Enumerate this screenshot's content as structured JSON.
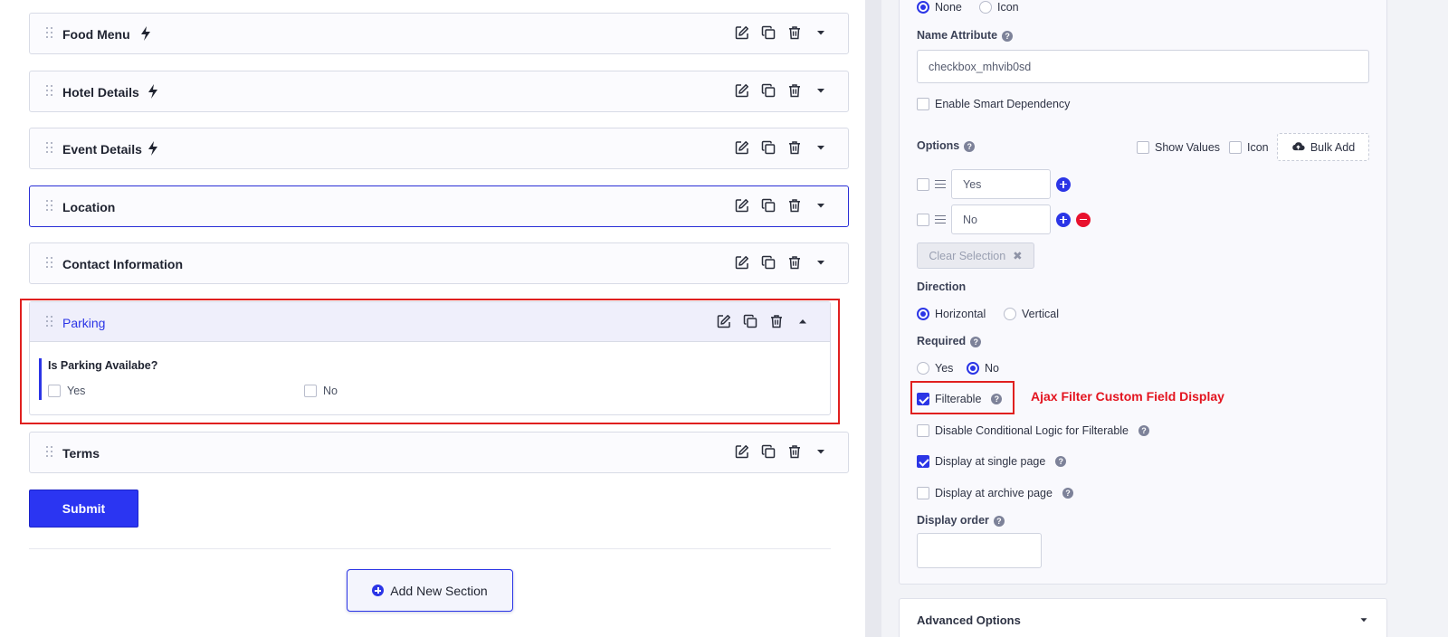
{
  "sections": [
    {
      "title": "Food Menu",
      "bolt": true
    },
    {
      "title": "Hotel Details",
      "bolt": true
    },
    {
      "title": "Event Details",
      "bolt": true
    },
    {
      "title": "Location",
      "bolt": false
    },
    {
      "title": "Contact Information",
      "bolt": false
    },
    {
      "title": "Parking",
      "bolt": false
    },
    {
      "title": "Terms",
      "bolt": false
    }
  ],
  "parking_field": {
    "label": "Is Parking Availabe?",
    "options": [
      "Yes",
      "No"
    ]
  },
  "buttons": {
    "submit": "Submit",
    "add_section": "Add New Section"
  },
  "settings": {
    "icon_type": {
      "options": [
        "None",
        "Icon"
      ],
      "selected": "None"
    },
    "name_attribute": {
      "label": "Name Attribute",
      "value": "checkbox_mhvib0sd"
    },
    "smart_dependency": {
      "label": "Enable Smart Dependency",
      "checked": false
    },
    "options": {
      "label": "Options",
      "show_values_label": "Show Values",
      "icon_label": "Icon",
      "bulk_add_label": "Bulk Add",
      "items": [
        "Yes",
        "No"
      ],
      "clear_label": "Clear Selection"
    },
    "direction": {
      "label": "Direction",
      "options": [
        "Horizontal",
        "Vertical"
      ],
      "selected": "Horizontal"
    },
    "required": {
      "label": "Required",
      "options": [
        "Yes",
        "No"
      ],
      "selected": "No"
    },
    "filterable": {
      "label": "Filterable",
      "checked": true
    },
    "disable_conditional": {
      "label": "Disable Conditional Logic for Filterable",
      "checked": false
    },
    "display_single": {
      "label": "Display at single page",
      "checked": true
    },
    "display_archive": {
      "label": "Display at archive page",
      "checked": false
    },
    "display_order": {
      "label": "Display order",
      "value": ""
    },
    "advanced": {
      "label": "Advanced Options"
    }
  },
  "annotation": "Ajax Filter Custom Field Display",
  "colors": {
    "accent": "#2b35e6",
    "highlight": "#e0201f",
    "annotation_text": "#e3141f"
  }
}
